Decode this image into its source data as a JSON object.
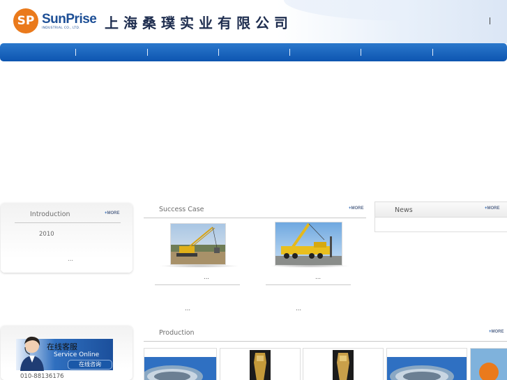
{
  "header": {
    "logo_mark": "SP",
    "logo_name": "SunPrise",
    "logo_subtitle": "INDUSTRIAL CO., LTD.",
    "company_name_cn": "上海桑璞实业有限公司"
  },
  "intro": {
    "title": "Introduction",
    "more": "MORE",
    "year": "2010",
    "ellipsis": "..."
  },
  "success_case": {
    "title": "Success Case",
    "more": "MORE",
    "items": [
      {
        "caption": "..."
      },
      {
        "caption": "..."
      }
    ],
    "bottom_items": [
      {
        "text": "..."
      },
      {
        "text": "..."
      }
    ]
  },
  "news": {
    "title": "News",
    "more": "MORE"
  },
  "production": {
    "title": "Production",
    "more": "MORE"
  },
  "service": {
    "title_cn": "在线客服",
    "title_en": "Service Online",
    "button_cn": "在线咨询",
    "phone": "010-88136176"
  },
  "colors": {
    "brand_orange": "#ea7a1c",
    "nav_blue": "#0d55b0",
    "brand_blue": "#1d4f96"
  }
}
